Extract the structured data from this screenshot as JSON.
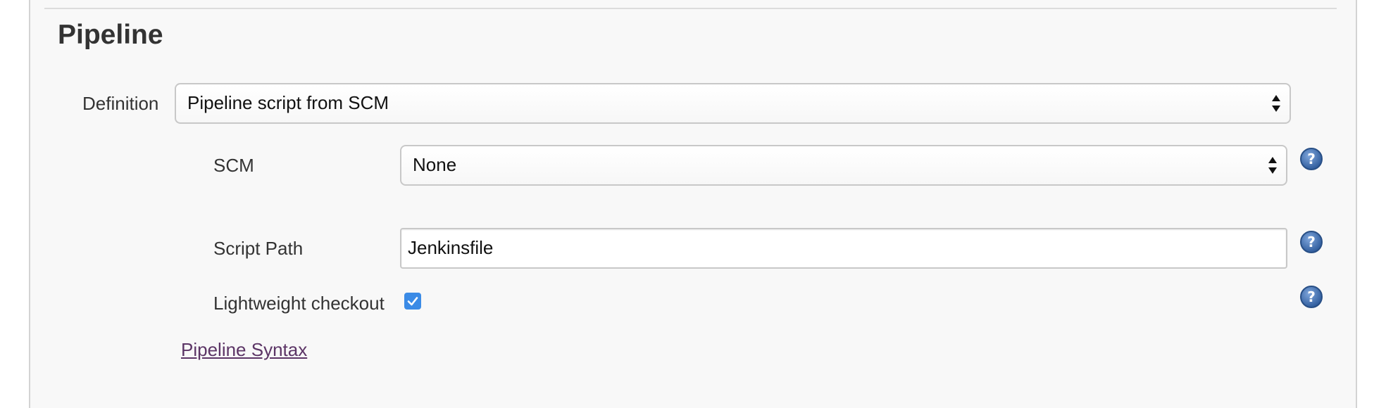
{
  "section": {
    "title": "Pipeline"
  },
  "definition": {
    "label": "Definition",
    "selected": "Pipeline script from SCM"
  },
  "scm": {
    "label": "SCM",
    "selected": "None"
  },
  "script_path": {
    "label": "Script Path",
    "value": "Jenkinsfile"
  },
  "lightweight_checkout": {
    "label": "Lightweight checkout",
    "checked": true
  },
  "links": {
    "pipeline_syntax": "Pipeline Syntax"
  },
  "icons": {
    "help": "help-icon",
    "select_arrows": "updown-arrows-icon",
    "checkmark": "checkmark-icon"
  },
  "colors": {
    "panel_background": "#f8f8f8",
    "help_icon": "#3d6aa8",
    "checkbox": "#3b8be6",
    "link": "#5c3566"
  }
}
